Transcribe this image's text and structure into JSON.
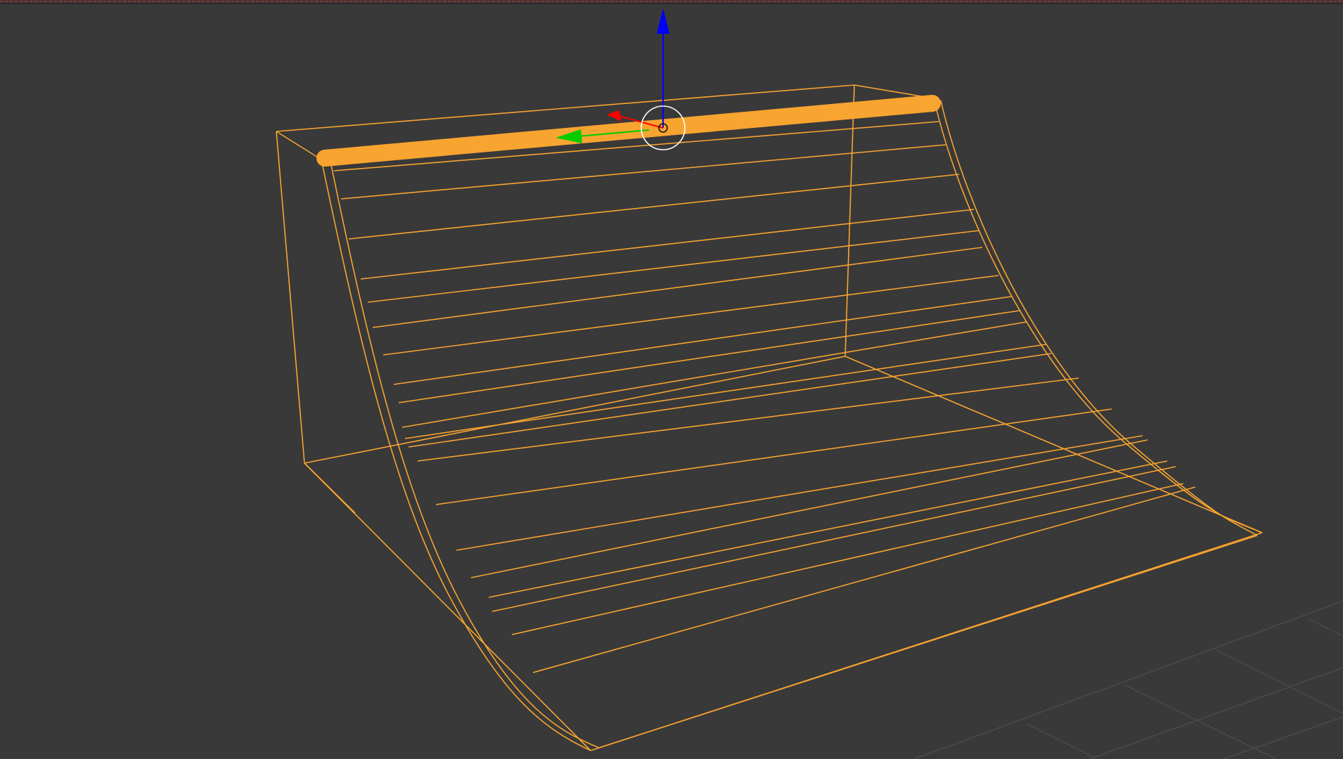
{
  "viewport": {
    "background": "#393939",
    "grid_color": "#505050",
    "selection_color": "#f8a430",
    "gizmo": {
      "z_axis_color": "#0000ff",
      "x_axis_color": "#ff0000",
      "y_axis_color": "#00cc00",
      "pivot_ring_color": "#ffffff"
    },
    "header_border_color": "#9b2b2b",
    "selected_object": "quarter-pipe-ramp",
    "selected_edge": "ramp-coping-edge"
  },
  "hud": {
    "label": ""
  }
}
